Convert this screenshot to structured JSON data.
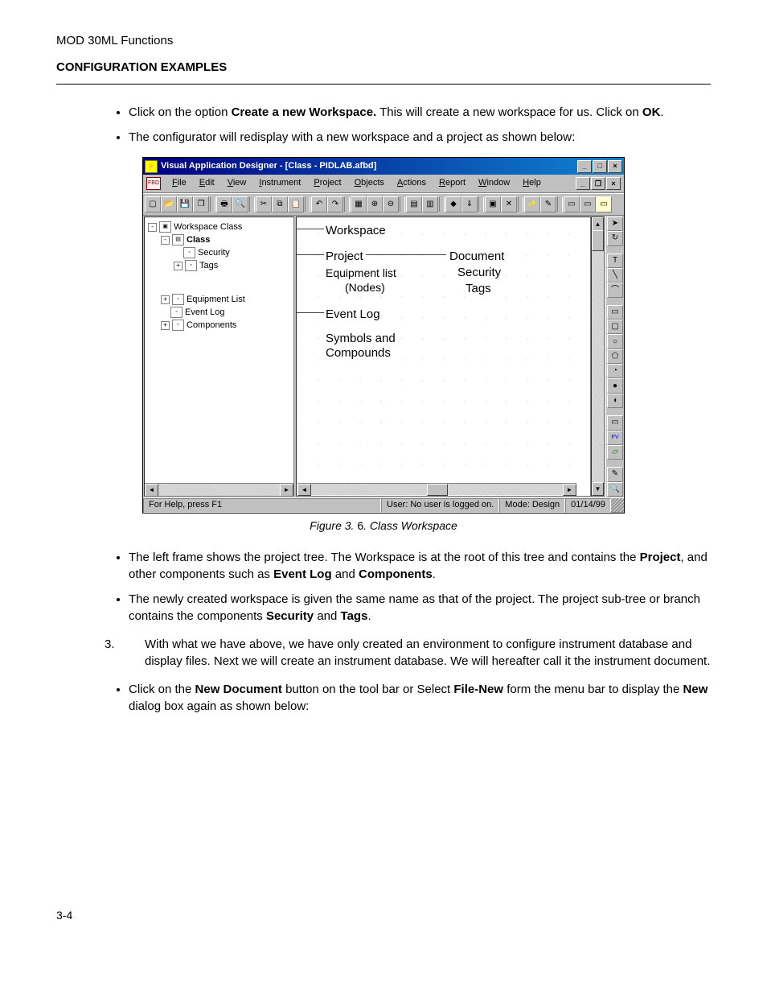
{
  "page": {
    "running_head": "MOD 30ML Functions",
    "section_title": "CONFIGURATION EXAMPLES",
    "page_number": "3-4"
  },
  "bullets_top": [
    {
      "pre": "Click on the option ",
      "b1": "Create a new Workspace.",
      "mid": " This will create a new workspace for us. Click on ",
      "b2": "OK",
      "post": "."
    },
    {
      "plain": "The configurator will redisplay with a new workspace and a project as shown below:"
    }
  ],
  "figure": {
    "caption_prefix": "Figure 3. ",
    "caption_num": "6",
    "caption_suffix": ". Class Workspace"
  },
  "bullets_mid": [
    {
      "pre": "The left frame shows the project tree. The Workspace is at the root of this tree and contains the ",
      "b1": "Project",
      "mid": ", and other components such as ",
      "b2": "Event Log",
      "mid2": " and ",
      "b3": "Components",
      "post": "."
    },
    {
      "pre": "The newly created workspace is given the same name as that of the project. The project sub-tree or branch contains the components ",
      "b1": "Security",
      "mid": " and ",
      "b2": "Tags",
      "post": "."
    }
  ],
  "num_item": {
    "num": "3.",
    "text": "With what we have above, we have only created an environment to configure instrument database and display files. Next we will create an instrument database. We will hereafter call it the instrument document."
  },
  "bullets_bottom": [
    {
      "pre": "Click on the ",
      "b1": "New Document",
      "mid": " button on the tool bar or Select ",
      "b2": "File-New",
      "mid2": " form the menu bar to display the ",
      "b3": "New",
      "post": " dialog box again as shown below:"
    }
  ],
  "app": {
    "title": "Visual Application Designer - [Class - PIDLAB.afbd]",
    "menus": [
      "File",
      "Edit",
      "View",
      "Instrument",
      "Project",
      "Objects",
      "Actions",
      "Report",
      "Window",
      "Help"
    ],
    "tree": {
      "root": "Workspace Class",
      "items": [
        {
          "indent": 1,
          "exp": "-",
          "bold": true,
          "label": "Class"
        },
        {
          "indent": 2,
          "exp": "",
          "label": "Security"
        },
        {
          "indent": 2,
          "exp": "+",
          "label": "Tags"
        },
        {
          "indent": 1,
          "exp": "+",
          "label": "Equipment List"
        },
        {
          "indent": 1,
          "exp": "",
          "label": "Event Log"
        },
        {
          "indent": 1,
          "exp": "+",
          "label": "Components"
        }
      ]
    },
    "annotations": {
      "workspace": "Workspace",
      "project": "Project",
      "equipment": "Equipment list",
      "nodes": "(Nodes)",
      "eventlog": "Event Log",
      "symbols1": "Symbols and",
      "symbols2": "Compounds",
      "document": "Document",
      "security": "Security",
      "tags": "Tags"
    },
    "status": {
      "help": "For Help, press F1",
      "user": "User:   No user is logged on.",
      "mode": "Mode:   Design",
      "date": "01/14/99"
    }
  }
}
